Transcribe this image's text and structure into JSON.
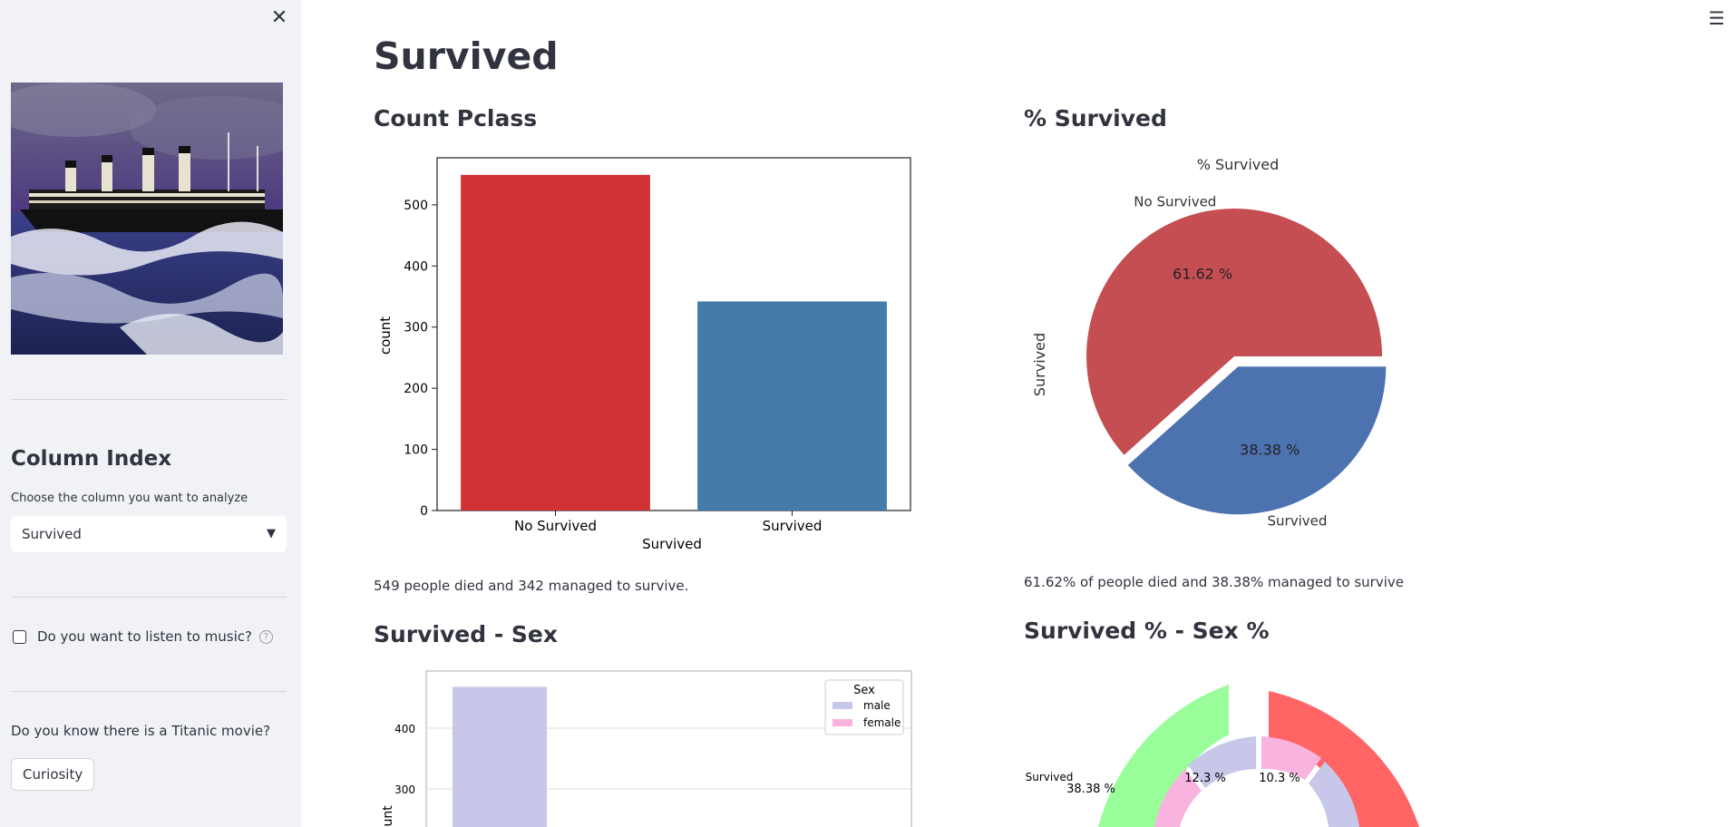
{
  "sidebar": {
    "close_icon": "close-icon",
    "image_alt": "Titanic painting",
    "title": "Column Index",
    "select_label": "Choose the column you want to analyze",
    "select_value": "Survived",
    "checkbox_label": "Do you want to listen to music?",
    "movie_question": "Do you know there is a Titanic movie?",
    "button_label": "Curiosity"
  },
  "main": {
    "menu_icon": "hamburger-menu-icon",
    "title": "Survived",
    "section_count": "Count Pclass",
    "caption_count": "549 people died and 342 managed to survive.",
    "section_pct": "% Survived",
    "caption_pct": "61.62% of people died and 38.38% managed to survive",
    "section_sex": "Survived - Sex",
    "section_pctsex": "Survived % - Sex %"
  },
  "chart_data": [
    {
      "type": "bar",
      "categories": [
        "No Survived",
        "Survived"
      ],
      "values": [
        549,
        342
      ],
      "colors": [
        "#d03235",
        "#457ba9"
      ],
      "xlabel": "Survived",
      "ylabel": "count",
      "ylim": [
        0,
        577
      ],
      "yticks": [
        0,
        100,
        200,
        300,
        400,
        500
      ]
    },
    {
      "type": "pie",
      "title": "% Survived",
      "labels": [
        "No Survived",
        "Survived"
      ],
      "values": [
        61.62,
        38.38
      ],
      "value_labels": [
        "61.62 %",
        "38.38 %"
      ],
      "colors": [
        "#c44e52",
        "#4c72b0"
      ],
      "ylabel": "Survived"
    },
    {
      "type": "bar",
      "legend_title": "Sex",
      "series": [
        {
          "name": "male",
          "color": "#c7c7ea"
        },
        {
          "name": "female",
          "color": "#f8b4de"
        }
      ],
      "first_bar_value": 468,
      "ylabel": "count",
      "yticks": [
        300,
        400
      ]
    },
    {
      "type": "pie",
      "outer_label": "Survived",
      "outer_value_label": "38.38 %",
      "inner_value_labels": [
        "12.3 %",
        "10.3 %"
      ],
      "colors": [
        "#99fe99",
        "#ff6565",
        "#c7c7ea",
        "#f8b4de"
      ]
    }
  ]
}
